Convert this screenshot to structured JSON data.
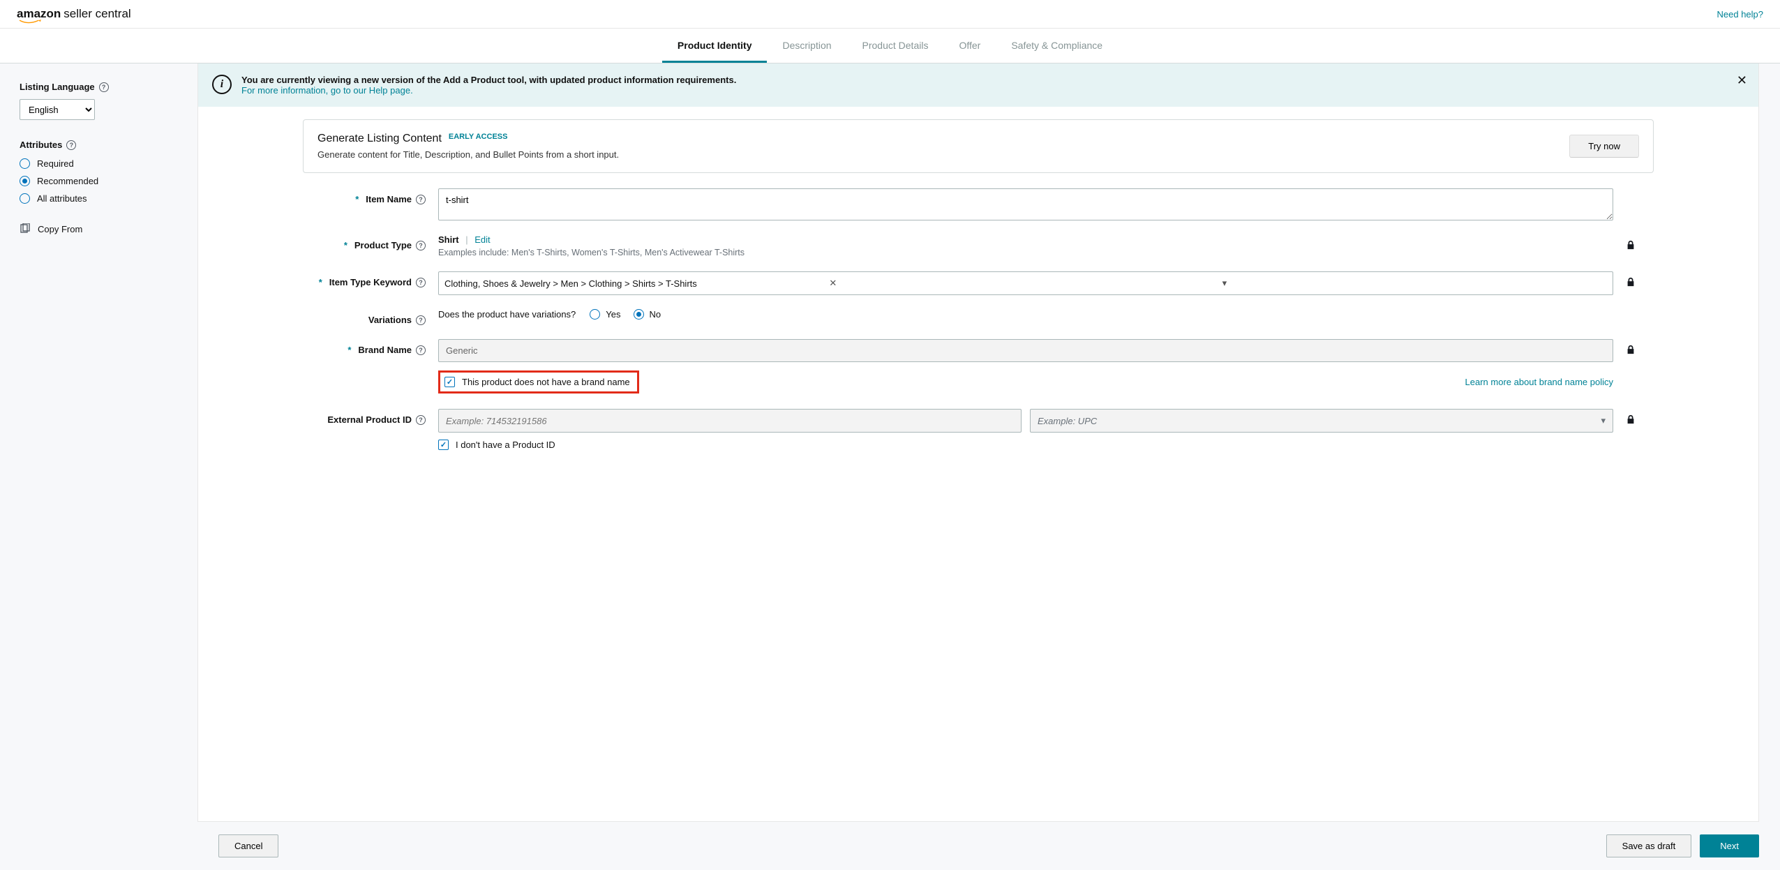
{
  "header": {
    "logo_main": "amazon",
    "logo_sub": "seller central",
    "help": "Need help?"
  },
  "tabs": [
    {
      "label": "Product Identity",
      "active": true
    },
    {
      "label": "Description",
      "active": false
    },
    {
      "label": "Product Details",
      "active": false
    },
    {
      "label": "Offer",
      "active": false
    },
    {
      "label": "Safety & Compliance",
      "active": false
    }
  ],
  "sidebar": {
    "lang_label": "Listing Language",
    "lang_value": "English",
    "attrs_label": "Attributes",
    "attrs": [
      {
        "label": "Required",
        "selected": false
      },
      {
        "label": "Recommended",
        "selected": true
      },
      {
        "label": "All attributes",
        "selected": false
      }
    ],
    "copy_from": "Copy From"
  },
  "banner": {
    "bold": "You are currently viewing a new version of the Add a Product tool, with updated product information requirements.",
    "link": "For more information, go to our Help page."
  },
  "gen": {
    "title": "Generate Listing Content",
    "badge": "EARLY ACCESS",
    "sub": "Generate content for Title, Description, and Bullet Points from a short input.",
    "cta": "Try now"
  },
  "form": {
    "item_name_label": "Item Name",
    "item_name_value": "t-shirt",
    "product_type_label": "Product Type",
    "product_type_value": "Shirt",
    "product_type_edit": "Edit",
    "product_type_examples": "Examples include: Men's T-Shirts, Women's T-Shirts, Men's Activewear T-Shirts",
    "item_type_kw_label": "Item Type Keyword",
    "item_type_kw_value": "Clothing, Shoes & Jewelry > Men > Clothing > Shirts > T-Shirts",
    "variations_label": "Variations",
    "variations_q": "Does the product have variations?",
    "variations_yes": "Yes",
    "variations_no": "No",
    "brand_label": "Brand Name",
    "brand_value": "Generic",
    "brand_cb": "This product does not have a brand name",
    "brand_link": "Learn more about brand name policy",
    "ext_id_label": "External Product ID",
    "ext_id_placeholder": "Example: 714532191586",
    "ext_id_type_placeholder": "Example: UPC",
    "ext_id_cb": "I don't have a Product ID"
  },
  "footer": {
    "cancel": "Cancel",
    "draft": "Save as draft",
    "next": "Next"
  }
}
